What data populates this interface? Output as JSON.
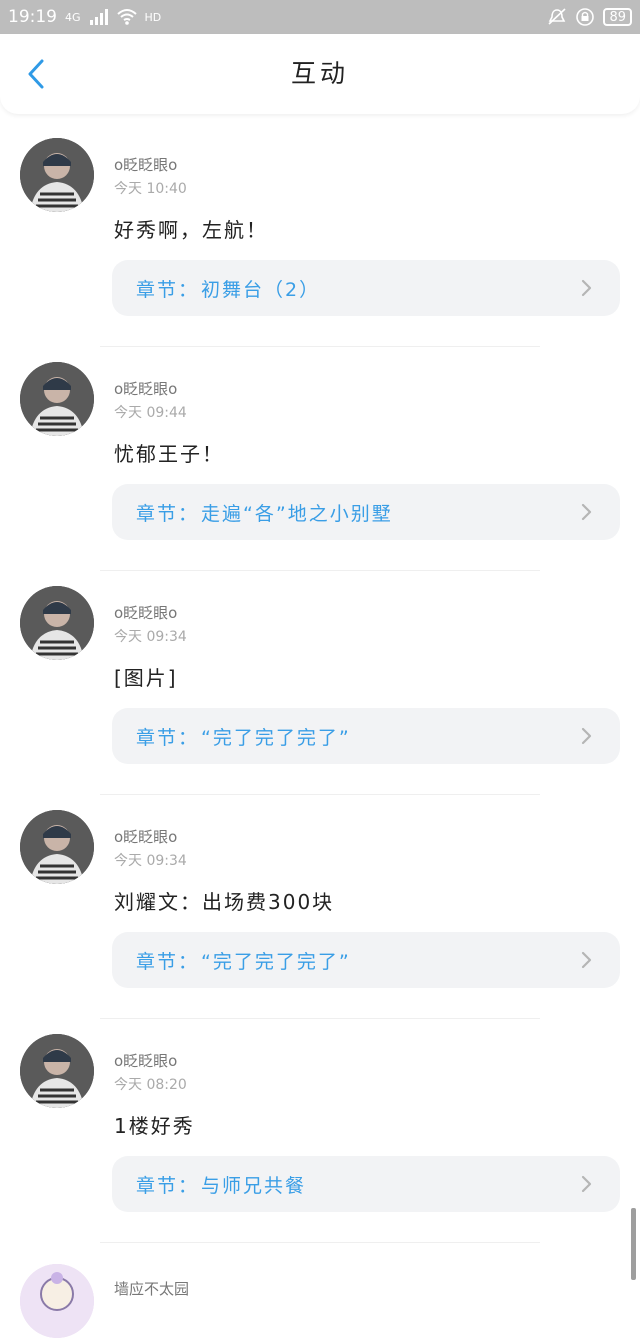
{
  "status_bar": {
    "time": "19:19",
    "network": "4G",
    "hd": "HD",
    "battery": "89"
  },
  "header": {
    "title": "互动"
  },
  "chapter_label": "章节：",
  "messages": [
    {
      "username": "o眨眨眼o",
      "time": "今天 10:40",
      "content": "好秀啊，左航！",
      "chapter": "初舞台（2）"
    },
    {
      "username": "o眨眨眼o",
      "time": "今天 09:44",
      "content": "忧郁王子！",
      "chapter": "走遍“各”地之小别墅"
    },
    {
      "username": "o眨眨眼o",
      "time": "今天 09:34",
      "content": "[图片]",
      "chapter": "“完了完了完了”"
    },
    {
      "username": "o眨眨眼o",
      "time": "今天 09:34",
      "content": "刘耀文：出场费300块",
      "chapter": "“完了完了完了”"
    },
    {
      "username": "o眨眨眼o",
      "time": "今天 08:20",
      "content": "1楼好秀",
      "chapter": "与师兄共餐"
    }
  ],
  "partial_item": {
    "username": "墙应不太园"
  },
  "colors": {
    "accent": "#3a9ee6",
    "status_bar": "#bdbdbd",
    "chapter_bg": "#f2f3f5"
  },
  "icons": [
    "back-arrow-icon",
    "chevron-right-icon",
    "wifi-icon",
    "signal-icon",
    "mute-icon",
    "lock-icon"
  ]
}
